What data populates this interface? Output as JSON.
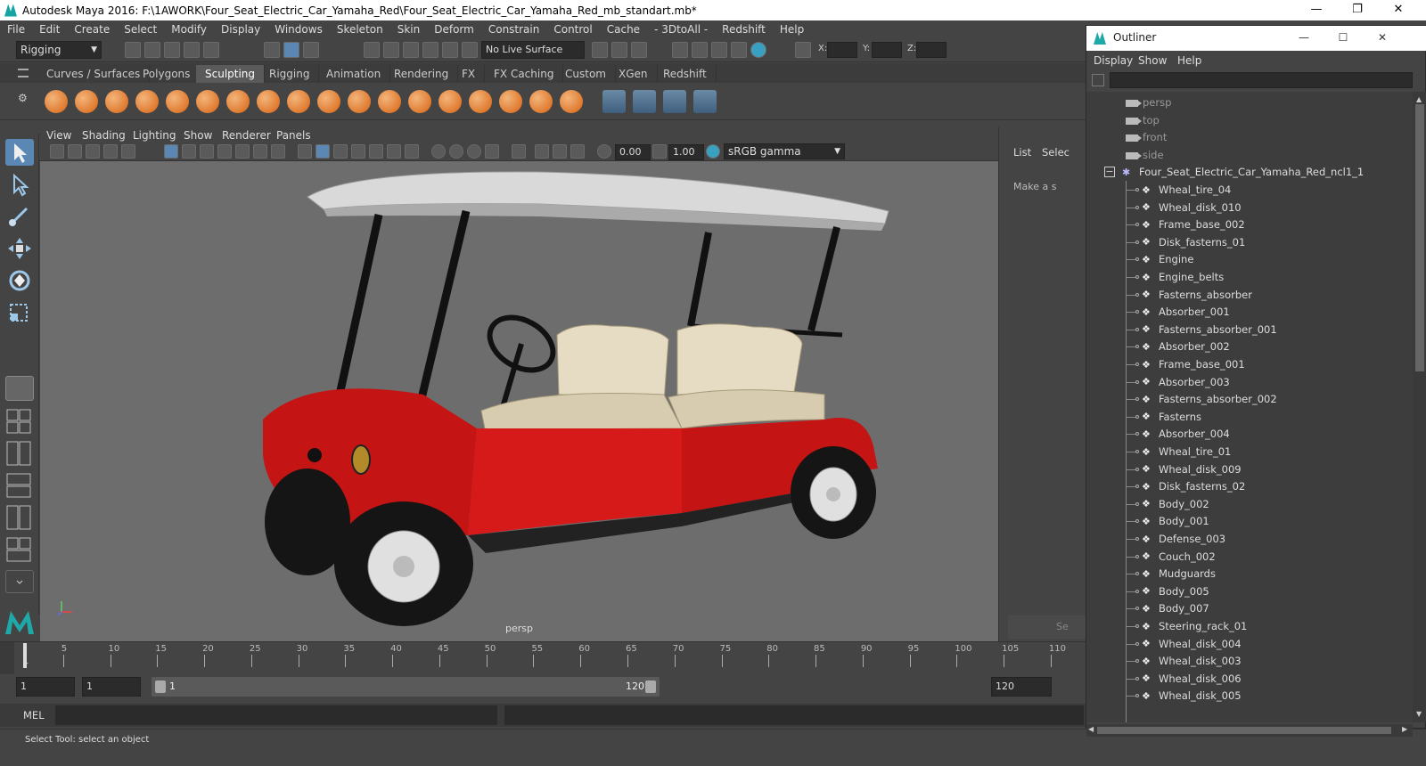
{
  "window": {
    "title": "Autodesk Maya 2016: F:\\1AWORK\\Four_Seat_Electric_Car_Yamaha_Red\\Four_Seat_Electric_Car_Yamaha_Red_mb_standart.mb*"
  },
  "menubar": [
    "File",
    "Edit",
    "Create",
    "Select",
    "Modify",
    "Display",
    "Windows",
    "Skeleton",
    "Skin",
    "Deform",
    "Constrain",
    "Control",
    "Cache",
    "- 3DtoAll -",
    "Redshift",
    "Help"
  ],
  "statusline": {
    "menuset": "Rigging",
    "live_surface": "No Live Surface",
    "x_label": "X:",
    "y_label": "Y:",
    "z_label": "Z:"
  },
  "shelf_tabs": [
    "Curves / Surfaces",
    "Polygons",
    "Sculpting",
    "Rigging",
    "Animation",
    "Rendering",
    "FX",
    "FX Caching",
    "Custom",
    "XGen",
    "Redshift"
  ],
  "active_shelf": "Sculpting",
  "viewport_menu": [
    "View",
    "Shading",
    "Lighting",
    "Show",
    "Renderer",
    "Panels"
  ],
  "viewport_tools": {
    "exposure": "0.00",
    "gamma": "1.00",
    "color_space": "sRGB gamma"
  },
  "viewport": {
    "camera": "persp"
  },
  "right_panel": {
    "list": "List",
    "select": "Selec",
    "hint": "Make a s",
    "bottom": "Se"
  },
  "outliner": {
    "title": "Outliner",
    "menu": [
      "Display",
      "Show",
      "Help"
    ],
    "cameras": [
      "persp",
      "top",
      "front",
      "side"
    ],
    "root": "Four_Seat_Electric_Car_Yamaha_Red_ncl1_1",
    "children": [
      "Wheal_tire_04",
      "Wheal_disk_010",
      "Frame_base_002",
      "Disk_fasterns_01",
      "Engine",
      "Engine_belts",
      "Fasterns_absorber",
      "Absorber_001",
      "Fasterns_absorber_001",
      "Absorber_002",
      "Frame_base_001",
      "Absorber_003",
      "Fasterns_absorber_002",
      "Fasterns",
      "Absorber_004",
      "Wheal_tire_01",
      "Wheal_disk_009",
      "Disk_fasterns_02",
      "Body_002",
      "Body_001",
      "Defense_003",
      "Couch_002",
      "Mudguards",
      "Body_005",
      "Body_007",
      "Steering_rack_01",
      "Wheal_disk_004",
      "Wheal_disk_003",
      "Wheal_disk_006",
      "Wheal_disk_005"
    ]
  },
  "timeslider": {
    "labels": [
      "5",
      "10",
      "15",
      "20",
      "25",
      "30",
      "35",
      "40",
      "45",
      "50",
      "55",
      "60",
      "65",
      "70",
      "75",
      "80",
      "85",
      "90",
      "95",
      "100",
      "105",
      "110"
    ],
    "current": "1"
  },
  "range": {
    "start": "1",
    "playback_start": "1",
    "range_start": "1",
    "range_end": "120",
    "end": "120"
  },
  "cmdline": {
    "label": "MEL"
  },
  "helpline": {
    "text": "Select Tool: select an object"
  }
}
